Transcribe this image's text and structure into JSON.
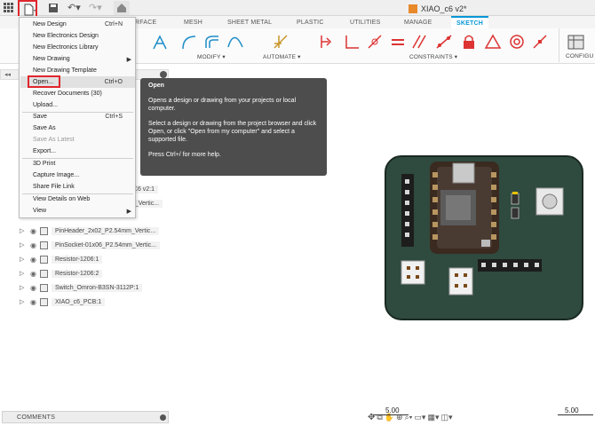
{
  "document": {
    "title": "XIAO_c6 v2*"
  },
  "workspace_tabs": [
    "RFACE",
    "MESH",
    "SHEET METAL",
    "PLASTIC",
    "UTILITIES",
    "MANAGE",
    "SKETCH"
  ],
  "ribbon": {
    "groups": [
      "MODIFY ▾",
      "AUTOMATE ▾",
      "CONSTRAINTS ▾",
      "CONFIGU"
    ]
  },
  "file_menu": {
    "items": [
      {
        "label": "New Design",
        "shortcut": "Ctrl+N"
      },
      {
        "label": "New Electronics Design",
        "shortcut": ""
      },
      {
        "label": "New Electronics Library",
        "shortcut": ""
      },
      {
        "label": "New Drawing",
        "shortcut": "▶"
      },
      {
        "label": "New Drawing Template",
        "shortcut": ""
      },
      {
        "label": "Open...",
        "shortcut": "Ctrl+O"
      },
      {
        "label": "Recover Documents (30)",
        "shortcut": ""
      },
      {
        "label": "Upload...",
        "shortcut": ""
      },
      {
        "label": "Save",
        "shortcut": "Ctrl+S"
      },
      {
        "label": "Save As",
        "shortcut": ""
      },
      {
        "label": "Save As Latest",
        "shortcut": ""
      },
      {
        "label": "Export...",
        "shortcut": ""
      },
      {
        "label": "3D Print",
        "shortcut": ""
      },
      {
        "label": "Capture Image...",
        "shortcut": ""
      },
      {
        "label": "Share File Link",
        "shortcut": ""
      },
      {
        "label": "View Details on Web",
        "shortcut": ""
      },
      {
        "label": "View",
        "shortcut": "▶"
      }
    ]
  },
  "tooltip": {
    "title": "Open",
    "line1": "Opens a design or drawing from your projects or local computer.",
    "line2": "Select a design or drawing from the project browser and click Open, or click \"Open from my computer\" and select a supported file.",
    "line3": "Press Ctrl+/ for more help."
  },
  "browser": {
    "partial_labels": [
      "2C6 v2:1",
      "m_Vertic..."
    ],
    "items": [
      "PinHeader_2x02_P2.54mm_Vertic...",
      "PinSocket-01x06_P2.54mm_Vertic...",
      "Resistor-1206:1",
      "Resistor-1206:2",
      "Switch_Omron-B3SN-3112P:1",
      "XIAO_c6_PCB:1"
    ]
  },
  "comments": {
    "label": "COMMENTS"
  },
  "dimensions": {
    "left": "5.00",
    "right": "5.00"
  },
  "colors": {
    "accent": "#0696d7",
    "highlight": "#e0262d",
    "pcb": "#2f4a3e"
  }
}
